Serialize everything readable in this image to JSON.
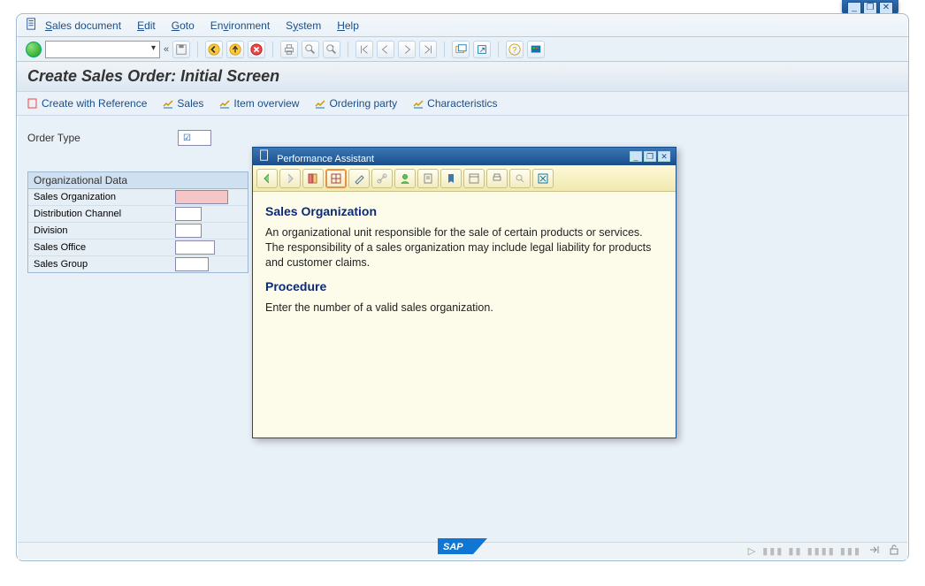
{
  "window_controls": {
    "minimize": "_",
    "restore": "❐",
    "close": "✕"
  },
  "menu": {
    "doc_icon": "document-icon",
    "items": [
      {
        "label": "Sales document",
        "ul": "S"
      },
      {
        "label": "Edit",
        "ul": "E"
      },
      {
        "label": "Goto",
        "ul": "G"
      },
      {
        "label": "Environment",
        "ul": "E"
      },
      {
        "label": "System",
        "ul": "S"
      },
      {
        "label": "Help",
        "ul": "H"
      }
    ]
  },
  "title": "Create Sales Order: Initial Screen",
  "action_strip": {
    "create_ref": "Create with Reference",
    "sales": "Sales",
    "item_overview": "Item overview",
    "ordering_party": "Ordering party",
    "characteristics": "Characteristics"
  },
  "fields": {
    "order_type_label": "Order Type",
    "order_type_value": ""
  },
  "org_data": {
    "section": "Organizational Data",
    "rows": [
      {
        "label": "Sales Organization",
        "value": "",
        "error": true
      },
      {
        "label": "Distribution Channel",
        "value": "",
        "error": false
      },
      {
        "label": "Division",
        "value": "",
        "error": false
      },
      {
        "label": "Sales Office",
        "value": "",
        "error": false
      },
      {
        "label": "Sales Group",
        "value": "",
        "error": false
      }
    ]
  },
  "pa": {
    "title": "Performance Assistant",
    "h1": "Sales Organization",
    "p1": "An organizational unit responsible for the sale of certain products or services. The responsibility of a sales organization may include legal liability for products and customer claims.",
    "h2": "Procedure",
    "p2": "Enter the number of a valid sales organization."
  },
  "footer": {
    "sap": "SAP",
    "play": "▷"
  }
}
